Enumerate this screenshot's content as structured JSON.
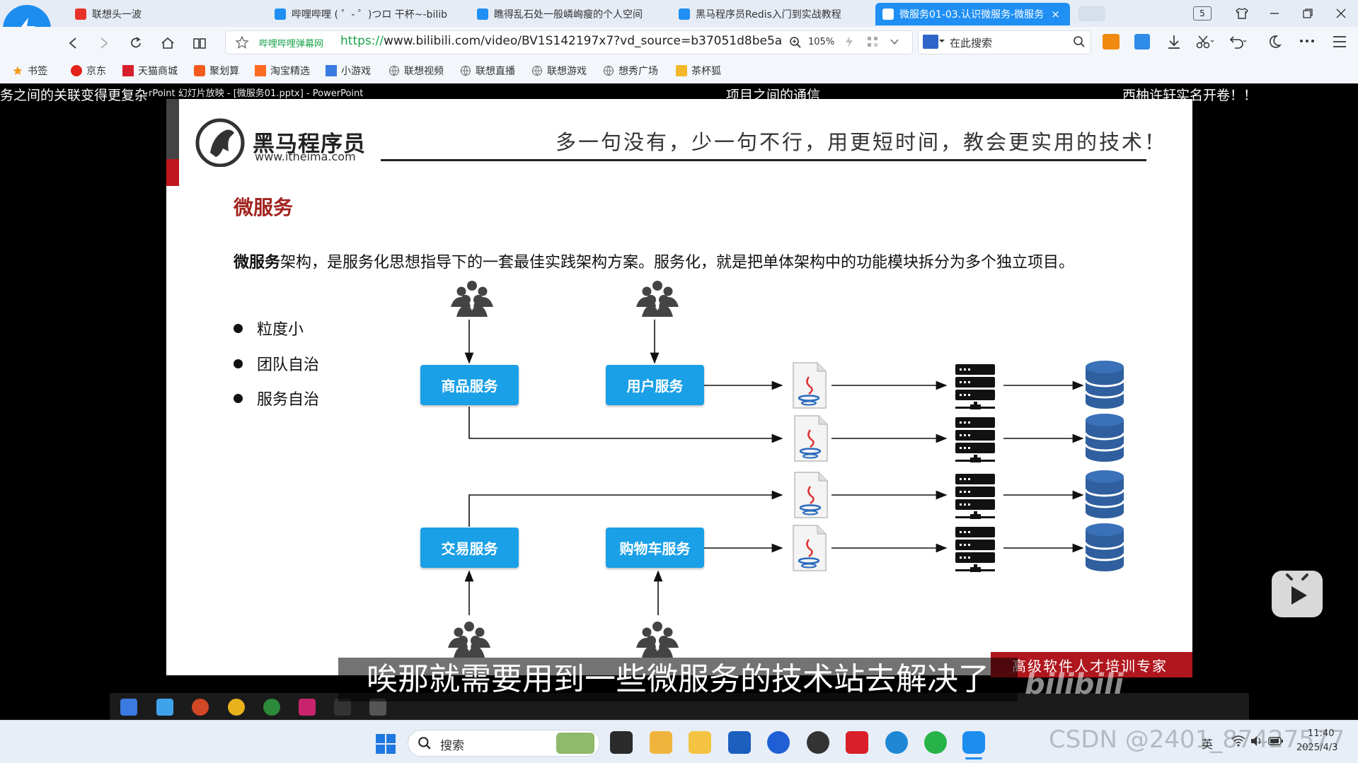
{
  "browser": {
    "tabs": [
      {
        "label": "联想头一波",
        "color": "#e8332a"
      },
      {
        "label": "哔哩哔哩 ( ゜- ゜)つロ 干杯~-bilib",
        "color": "#1f8ff3"
      },
      {
        "label": "瞧得乱石处一般嶙峋瘦的个人空间",
        "color": "#1f8ff3"
      },
      {
        "label": "黑马程序员Redis入门到实战教程",
        "color": "#1f8ff3"
      },
      {
        "label": "微服务01-03.认识微服务-微服务",
        "color": "#ffffff",
        "close": "×"
      }
    ],
    "tab_count": "5",
    "site_name": "哔哩哔哩弹幕网",
    "url_proto": "https://",
    "url_rest": "www.bilibili.com/video/BV1S142197x7?vd_source=b37051d8be5a",
    "zoom": "105%",
    "search_placeholder": "在此搜索",
    "bookmarks": [
      {
        "label": "书签",
        "color": "#f39a1b"
      },
      {
        "label": "京东",
        "color": "#e2231a"
      },
      {
        "label": "天猫商城",
        "color": "#d61f2c"
      },
      {
        "label": "聚划算",
        "color": "#f35b1c"
      },
      {
        "label": "淘宝精选",
        "color": "#ff6b22"
      },
      {
        "label": "小游戏",
        "color": "#3b7ae0"
      },
      {
        "label": "联想视频",
        "color": "#777777"
      },
      {
        "label": "联想直播",
        "color": "#777777"
      },
      {
        "label": "联想游戏",
        "color": "#777777"
      },
      {
        "label": "想秀广场",
        "color": "#777777"
      },
      {
        "label": "茶杯狐",
        "color": "#f2b82a"
      }
    ]
  },
  "video": {
    "danmaku_left": "务之间的关联变得更复杂",
    "ppt_caption": "rPoint 幻灯片放映 - [微服务01.pptx] - PowerPoint",
    "danmaku_mid": "项目之间的通信",
    "danmaku_right": "西柚许轩实名开卷！！",
    "subtitle": "唉那就需要用到一些微服务的技术站去解决了",
    "bili_watermark": "bilibili"
  },
  "slide": {
    "brand_name": "黑马程序员",
    "brand_url": "www.itheima.com",
    "slogan": "多一句没有，少一句不行，用更短时间，教会更实用的技术！",
    "title": "微服务",
    "para_bold": "微服务",
    "para_rest": "架构，是服务化思想指导下的一套最佳实践架构方案。服务化，就是把单体架构中的功能模块拆分为多个独立项目。",
    "bullets": [
      "粒度小",
      "团队自治",
      "服务自治"
    ],
    "services": [
      "商品服务",
      "用户服务",
      "交易服务",
      "购物车服务"
    ],
    "footer": "高级软件人才培训专家"
  },
  "taskbar": {
    "search": "搜索",
    "lang": "英",
    "time": "11:40",
    "date": "2025/4/3",
    "csdn_watermark": "CSDN @2401_87427577"
  },
  "colors": {
    "accent": "#1f8ff3",
    "service_box": "#1aa0e6",
    "db": "#2f5f9e",
    "brand_red": "#a2231f"
  }
}
